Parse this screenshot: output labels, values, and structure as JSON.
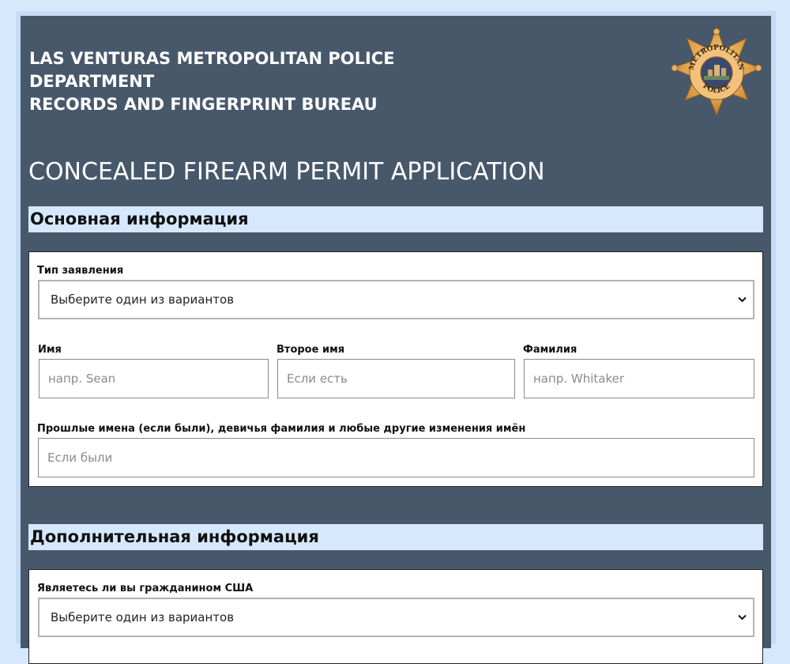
{
  "header": {
    "line1": "LAS VENTURAS METROPOLITAN POLICE",
    "line2": "DEPARTMENT",
    "line3": "RECORDS AND FINGERPRINT BUREAU",
    "badge": {
      "top_text": "METROPOLITAN",
      "bottom_text": "POLICE",
      "icon": "police-star-badge"
    }
  },
  "form_title": "CONCEALED FIREARM PERMIT APPLICATION",
  "sections": {
    "basic": {
      "title": "Основная информация",
      "application_type": {
        "label": "Тип заявления",
        "value": "Выберите один из вариантов"
      },
      "first_name": {
        "label": "Имя",
        "placeholder": "напр. Sean"
      },
      "middle_name": {
        "label": "Второе имя",
        "placeholder": "Если есть"
      },
      "last_name": {
        "label": "Фамилия",
        "placeholder": "напр. Whitaker"
      },
      "previous_names": {
        "label": "Прошлые имена (если были), девичья фамилия и любые другие изменения имён",
        "placeholder": "Если были"
      }
    },
    "additional": {
      "title": "Дополнительная информация",
      "us_citizen": {
        "label": "Являетесь ли вы гражданином США",
        "value": "Выберите один из вариантов"
      }
    }
  },
  "colors": {
    "panel_bg": "#48586b",
    "section_bar": "#d6e8fd",
    "page_bg": "#d6e8fb"
  }
}
